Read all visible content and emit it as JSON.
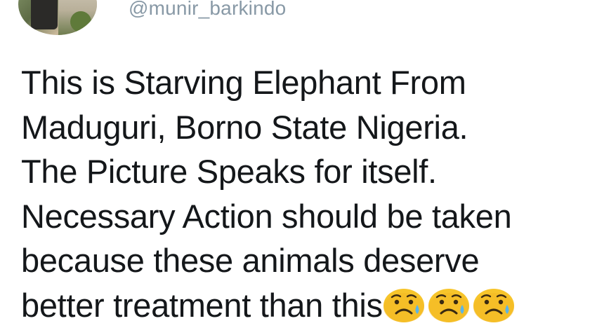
{
  "tweet": {
    "handle": "@munir_barkindo",
    "text_lines": [
      "This is Starving Elephant From",
      "Maduguri, Borno State Nigeria.",
      "The Picture Speaks for itself.",
      "Necessary Action should be taken",
      "because these animals deserve",
      "better treatment than this"
    ],
    "emojis": [
      "sad-face-with-sweat-icon",
      "sad-face-with-sweat-icon",
      "sad-face-with-sweat-icon"
    ]
  },
  "colors": {
    "text": "#14171a",
    "handle": "#8899a6",
    "emoji_face": "#f7c52b",
    "emoji_drop": "#5ab4e8"
  }
}
